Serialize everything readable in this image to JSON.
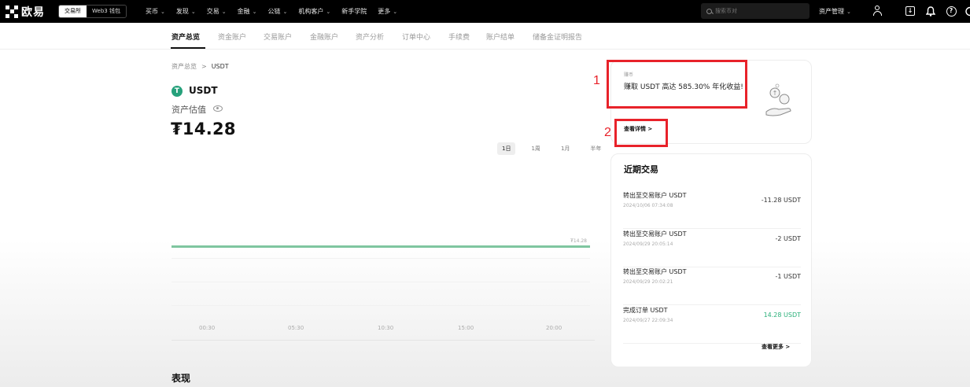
{
  "header": {
    "logo_text": "欧易",
    "mode_exchange": "交易所",
    "mode_web3": "Web3 钱包",
    "nav": [
      "买币",
      "发现",
      "交易",
      "金融",
      "公链",
      "机构客户",
      "新手学院",
      "更多"
    ],
    "search_placeholder": "搜索币对",
    "asset_mgmt": "资产管理"
  },
  "subnav": {
    "items": [
      "资产总览",
      "资金账户",
      "交易账户",
      "金融账户",
      "资产分析",
      "订单中心",
      "手续费",
      "账户结单",
      "储备金证明报告"
    ],
    "active_index": 0
  },
  "main": {
    "breadcrumb": [
      "资产总览",
      "USDT"
    ],
    "coin_symbol": "T",
    "coin_name": "USDT",
    "est_label": "资产估值",
    "balance": "₮14.28",
    "ranges": [
      "1日",
      "1周",
      "1月",
      "半年"
    ],
    "active_range": 0,
    "perf_title": "表现"
  },
  "chart_data": {
    "type": "line",
    "x": [
      "00:30",
      "05:30",
      "10:30",
      "15:00",
      "20:00"
    ],
    "series": [
      {
        "values": [
          14.28,
          14.28,
          14.28,
          14.28,
          14.28
        ]
      }
    ],
    "end_label": "₮14.28"
  },
  "promo": {
    "tag": "赚币",
    "text": "赚取 USDT 高达 585.30% 年化收益!",
    "link": "查看详情 >"
  },
  "annotations": [
    "1",
    "2"
  ],
  "trades": {
    "title": "近期交易",
    "rows": [
      {
        "name": "转出至交易账户 USDT",
        "time": "2024/10/06 07:34:08",
        "amount": "-11.28 USDT",
        "positive": false
      },
      {
        "name": "转出至交易账户 USDT",
        "time": "2024/09/29 20:05:14",
        "amount": "-2 USDT",
        "positive": false
      },
      {
        "name": "转出至交易账户 USDT",
        "time": "2024/09/29 20:02:21",
        "amount": "-1 USDT",
        "positive": false
      },
      {
        "name": "完成订单 USDT",
        "time": "2024/09/27 22:09:34",
        "amount": "14.28 USDT",
        "positive": true
      }
    ],
    "more": "查看更多 >"
  },
  "colors": {
    "accent_green": "#2bb07a",
    "chart_line": "#7fc6a0",
    "annotation_red": "#e8222a",
    "usdt": "#26a17b"
  }
}
